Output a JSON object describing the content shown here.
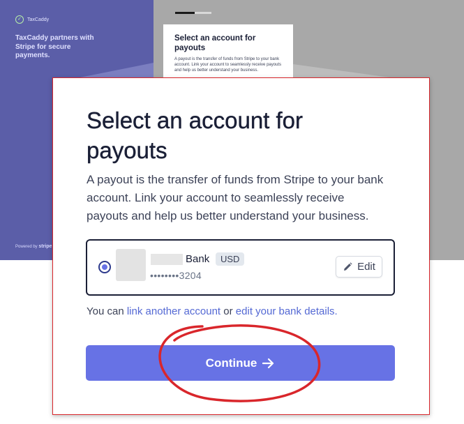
{
  "background": {
    "brand_name": "TaxCaddy",
    "partner_text": "TaxCaddy partners with Stripe for secure payments.",
    "powered_by": "Powered by",
    "powered_brand": "stripe",
    "card_title": "Select an account for payouts",
    "card_text": "A payout is the transfer of funds from Stripe to your bank account. Link your account to seamlessly receive payouts and help us better understand your business."
  },
  "dialog": {
    "title": "Select an account for payouts",
    "description": "A payout is the transfer of funds from Stripe to your bank account. Link your account to seamlessly receive payouts and help us better understand your business.",
    "account": {
      "bank_name": "Bank",
      "currency": "USD",
      "masked_number": "••••••••3204",
      "edit_label": "Edit"
    },
    "links": {
      "prefix": "You can",
      "link_another": "link another account",
      "middle": "or",
      "edit_details": "edit your bank details."
    },
    "continue_label": "Continue"
  },
  "colors": {
    "accent": "#6772e5",
    "link": "#5469d4",
    "sidebar": "#5b5ea8",
    "annotation": "#d9262b"
  },
  "icons": [
    "check-icon",
    "radio-selected-icon",
    "pencil-icon",
    "arrow-right-icon"
  ]
}
